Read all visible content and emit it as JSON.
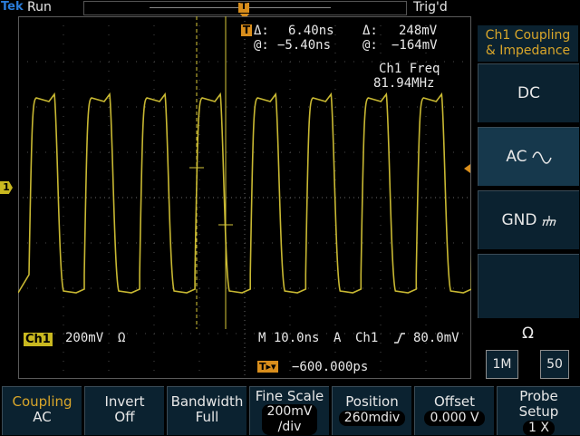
{
  "status": {
    "brand": "Tek",
    "run_state": "Run",
    "trigger_state": "Trig'd",
    "record_marker": "T"
  },
  "cursors": {
    "marker": "T",
    "delta_time_label": "Δ:",
    "delta_time": "6.40ns",
    "delta_volt_label": "Δ:",
    "delta_volt": "248mV",
    "at_time_label": "@:",
    "at_time": "−5.40ns",
    "at_volt_label": "@:",
    "at_volt": "−164mV"
  },
  "measurement": {
    "label": "Ch1 Freq",
    "value": "81.94MHz"
  },
  "channel": {
    "badge": "Ch1",
    "indicator": "1",
    "scale": "200mV",
    "scale_unit": "Ω"
  },
  "timebase": {
    "horizontal": "M 10.0ns",
    "trigger_mode": "A",
    "trigger_source": "Ch1",
    "trigger_slope_icon": "rising-edge-icon",
    "trigger_level": "80.0mV",
    "trigger_position_marker": "T",
    "trigger_position": "−600.000ps"
  },
  "side_menu": {
    "title_line1": "Ch1 Coupling",
    "title_line2": "& Impedance",
    "items": [
      {
        "label": "DC"
      },
      {
        "label": "AC",
        "icon": "sine-wave-icon"
      },
      {
        "label": "GND",
        "icon": "ground-icon"
      }
    ],
    "impedance_label": "Ω",
    "impedance_options": [
      "1M",
      "50"
    ]
  },
  "bottom_menu": [
    {
      "title": "Coupling",
      "value": "AC"
    },
    {
      "title": "Invert",
      "value": "Off"
    },
    {
      "title": "Bandwidth",
      "value": "Full"
    },
    {
      "title": "Fine Scale",
      "value": "200mV",
      "value2": "/div"
    },
    {
      "title": "Position",
      "value": "260mdiv"
    },
    {
      "title": "Offset",
      "value": "0.000 V"
    },
    {
      "title": "Probe",
      "value": "Setup",
      "value2": "1 X"
    }
  ],
  "colors": {
    "trace": "#c8b832",
    "accent_orange": "#d98e1c",
    "menu_bg": "#0b2230",
    "title_gold": "#d9a62a"
  }
}
